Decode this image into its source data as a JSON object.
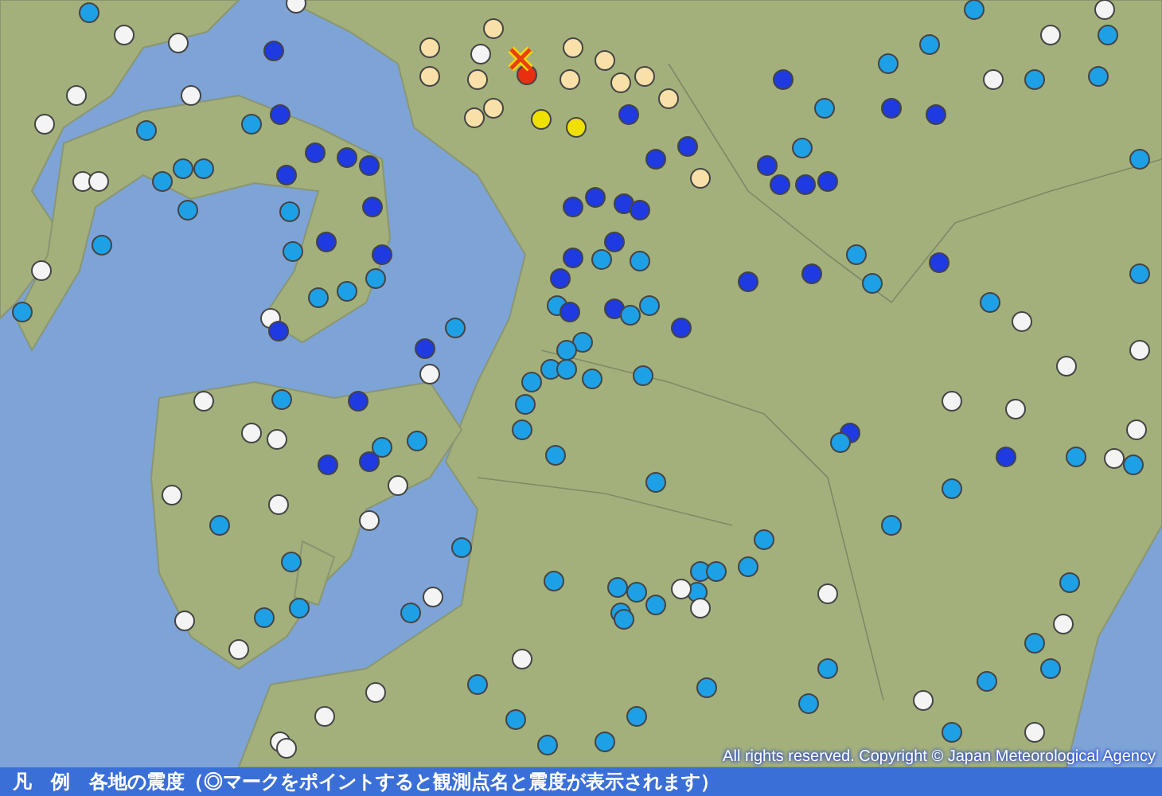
{
  "map": {
    "copyright": "All rights reserved. Copyright © Japan Meteorological Agency"
  },
  "legend": {
    "title": "凡　例",
    "text": "各地の震度（◎マークをポイントすると観測点名と震度が表示されます）"
  }
}
